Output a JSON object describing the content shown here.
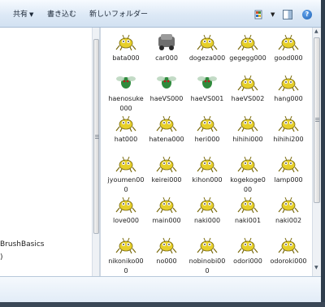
{
  "toolbar": {
    "share_label": "共有",
    "write_label": "書き込む",
    "new_folder_label": "新しいフォルダー",
    "view_icon": "view-options-icon",
    "preview_icon": "preview-pane-icon",
    "help_icon": "help-icon",
    "help_glyph": "?"
  },
  "nav": {
    "items": [
      "BrushBasics",
      ")"
    ]
  },
  "files": [
    {
      "name": "bata000",
      "icon": "creature-thumbnail"
    },
    {
      "name": "car000",
      "icon": "car-thumbnail"
    },
    {
      "name": "dogeza000",
      "icon": "creature-thumbnail"
    },
    {
      "name": "gegegg000",
      "icon": "creature-thumbnail"
    },
    {
      "name": "good000",
      "icon": "creature-thumbnail"
    },
    {
      "name": "haenosuke000",
      "icon": "fly-thumbnail"
    },
    {
      "name": "haeVS000",
      "icon": "fly-thumbnail"
    },
    {
      "name": "haeVS001",
      "icon": "fly-thumbnail"
    },
    {
      "name": "haeVS002",
      "icon": "creature-thumbnail"
    },
    {
      "name": "hang000",
      "icon": "creature-thumbnail"
    },
    {
      "name": "hat000",
      "icon": "creature-thumbnail"
    },
    {
      "name": "hatena000",
      "icon": "creature-thumbnail"
    },
    {
      "name": "heri000",
      "icon": "creature-thumbnail"
    },
    {
      "name": "hihihi000",
      "icon": "creature-thumbnail"
    },
    {
      "name": "hihihi200",
      "icon": "creature-thumbnail"
    },
    {
      "name": "jyoumen000",
      "icon": "creature-thumbnail"
    },
    {
      "name": "keirei000",
      "icon": "creature-thumbnail"
    },
    {
      "name": "kihon000",
      "icon": "creature-thumbnail"
    },
    {
      "name": "kogekoge000",
      "icon": "creature-thumbnail"
    },
    {
      "name": "lamp000",
      "icon": "creature-thumbnail"
    },
    {
      "name": "love000",
      "icon": "creature-thumbnail"
    },
    {
      "name": "main000",
      "icon": "creature-thumbnail"
    },
    {
      "name": "naki000",
      "icon": "creature-thumbnail"
    },
    {
      "name": "naki001",
      "icon": "creature-thumbnail"
    },
    {
      "name": "naki002",
      "icon": "creature-thumbnail"
    },
    {
      "name": "nikoniko000",
      "icon": "creature-thumbnail"
    },
    {
      "name": "no000",
      "icon": "creature-thumbnail"
    },
    {
      "name": "nobinobi000",
      "icon": "creature-thumbnail"
    },
    {
      "name": "odori000",
      "icon": "creature-thumbnail"
    },
    {
      "name": "odoroki000",
      "icon": "creature-thumbnail"
    }
  ],
  "colors": {
    "creature": "#e6cf2a",
    "creature_dark": "#7a6a0c",
    "accent_pink": "#e14aa8",
    "accent_green": "#2f8a3c",
    "selection": "#cce8ff"
  }
}
